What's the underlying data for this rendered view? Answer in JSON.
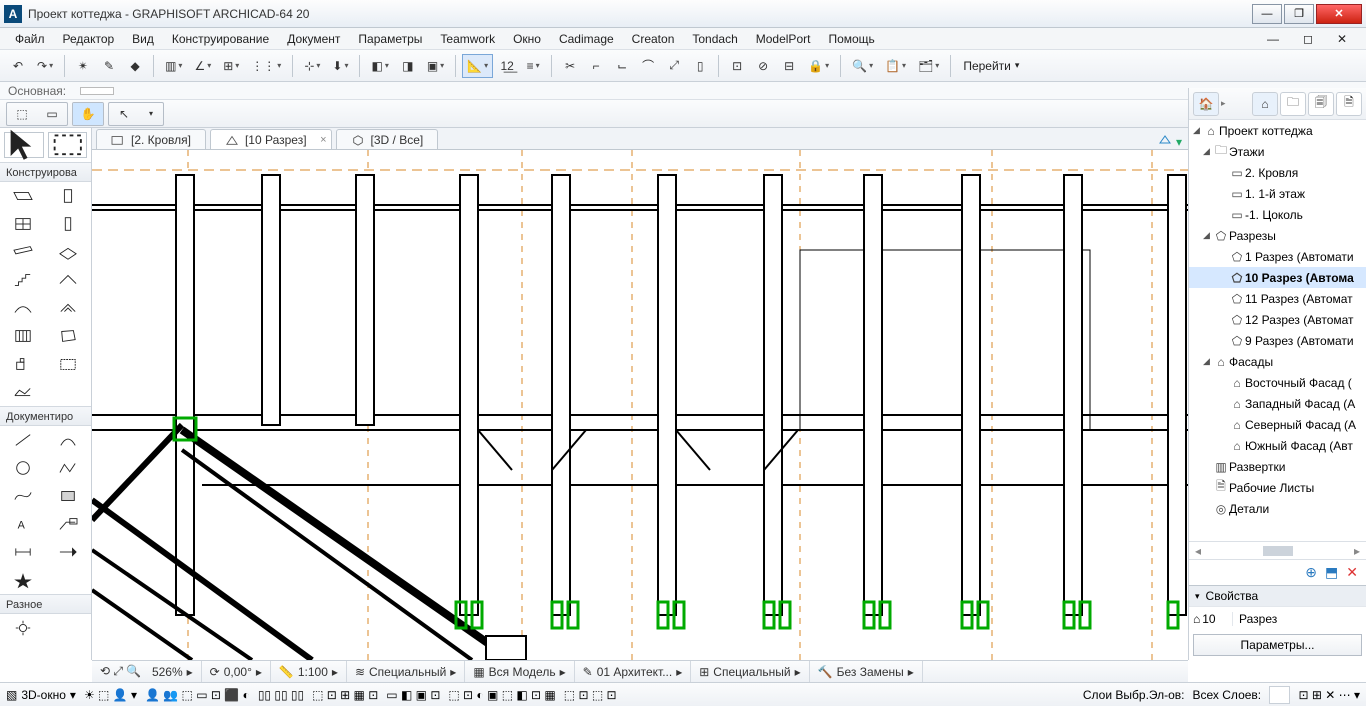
{
  "window": {
    "title": "Проект коттеджа - GRAPHISOFT ARCHICAD-64 20"
  },
  "menu": [
    "Файл",
    "Редактор",
    "Вид",
    "Конструирование",
    "Документ",
    "Параметры",
    "Teamwork",
    "Окно",
    "Cadimage",
    "Creaton",
    "Tondach",
    "ModelPort",
    "Помощь"
  ],
  "goto": "Перейти",
  "indicator": {
    "label": "Основная:"
  },
  "tabs": [
    {
      "label": "[2. Кровля]",
      "kind": "plan",
      "active": false
    },
    {
      "label": "[10 Разрез]",
      "kind": "section",
      "active": true,
      "closable": true
    },
    {
      "label": "[3D / Все]",
      "kind": "3d",
      "active": false
    }
  ],
  "toolbox": {
    "design_header": "Конструирова",
    "document_header": "Документиро",
    "misc_header": "Разное"
  },
  "navigator": {
    "root": "Проект коттеджа",
    "stories": {
      "label": "Этажи",
      "items": [
        "2. Кровля",
        "1. 1-й этаж",
        "-1. Цоколь"
      ]
    },
    "sections": {
      "label": "Разрезы",
      "items": [
        "1 Разрез (Автомати",
        "10 Разрез (Автома",
        "11 Разрез (Автомат",
        "12 Разрез (Автомат",
        "9 Разрез (Автомати"
      ],
      "selected": 1
    },
    "elevations": {
      "label": "Фасады",
      "items": [
        "Восточный Фасад (",
        "Западный Фасад (А",
        "Северный Фасад (А",
        "Южный Фасад (Авт"
      ]
    },
    "interior": "Развертки",
    "worksheets": "Рабочие Листы",
    "details": "Детали"
  },
  "properties": {
    "header": "Свойства",
    "id": "10",
    "name": "Разрез",
    "button": "Параметры..."
  },
  "status": {
    "zoom": "526%",
    "angle": "0,00°",
    "scale": "1:100",
    "layercombo": "Специальный",
    "model": "Вся Модель",
    "penset": "01 Архитект...",
    "mvo": "Специальный",
    "renov": "Без Замены",
    "view3d": "3D-окно",
    "layerSel": "Слои Выбр.Эл-ов:",
    "layerAll": "Всех Слоев:"
  }
}
